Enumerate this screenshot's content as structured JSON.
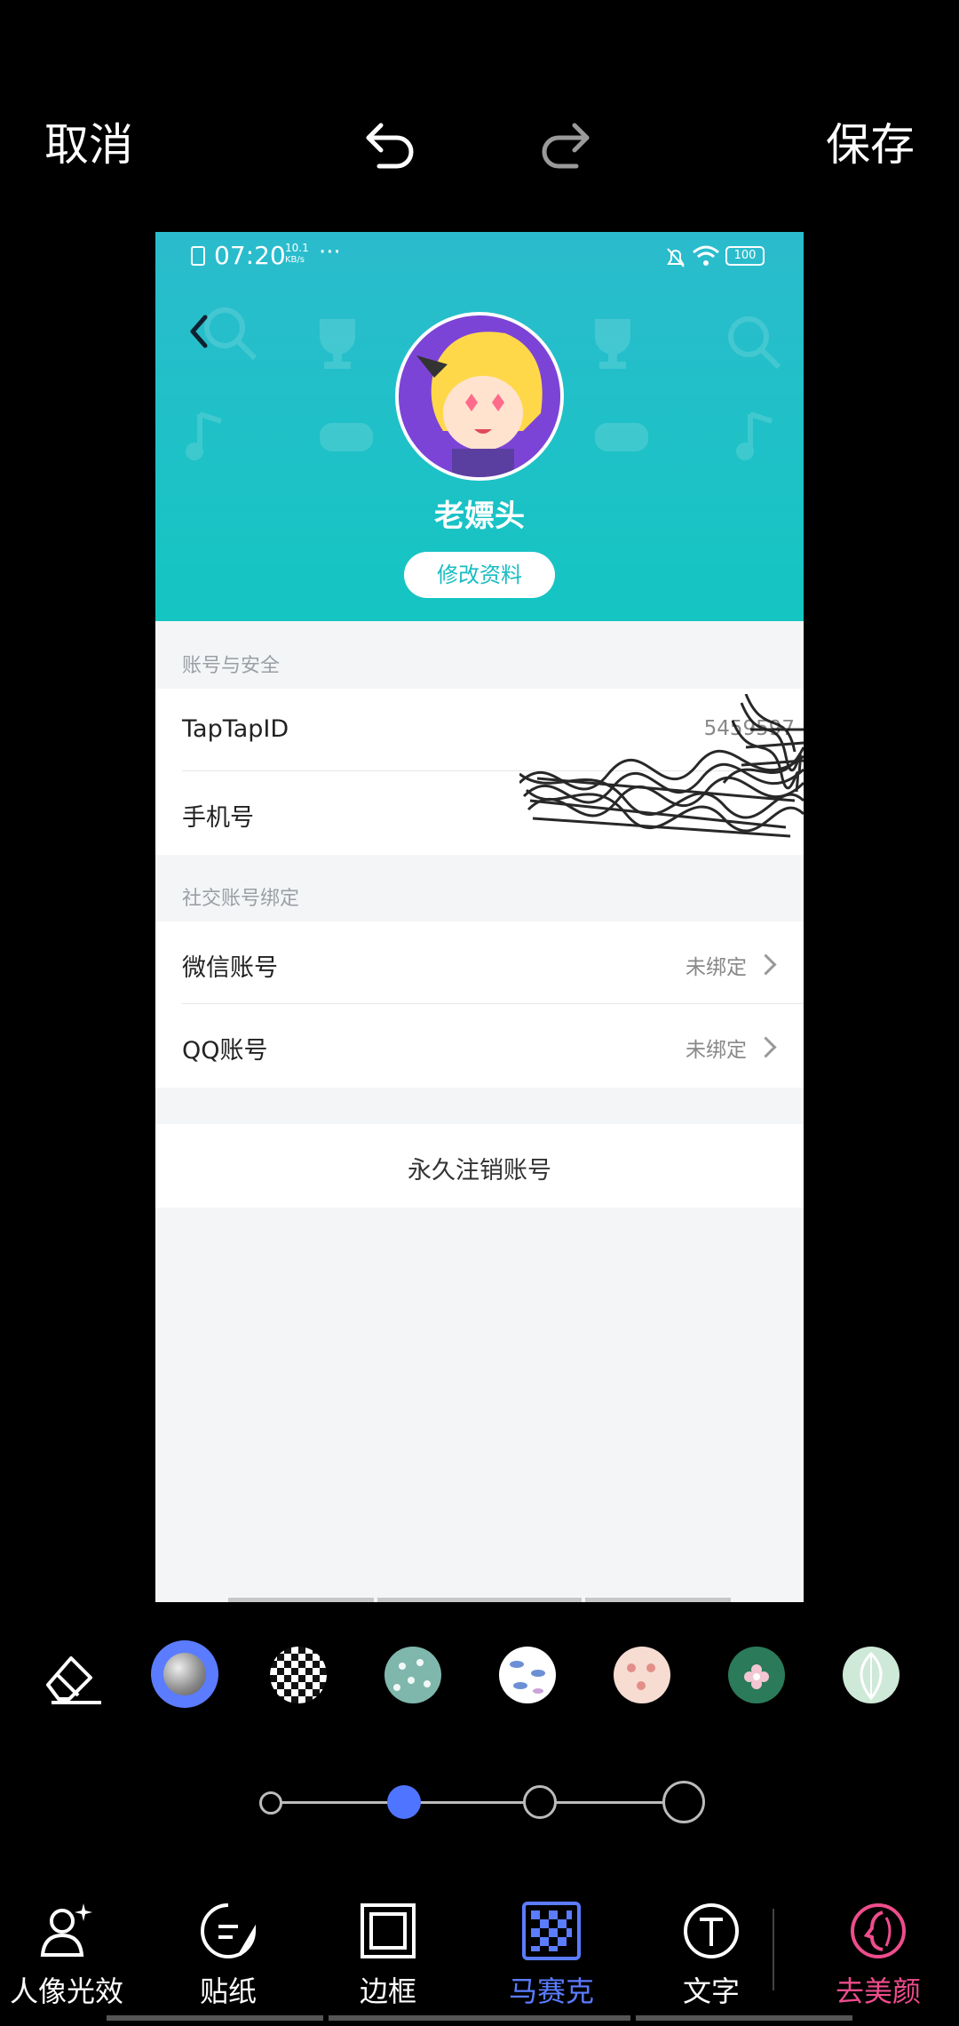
{
  "topbar": {
    "cancel_label": "取消",
    "save_label": "保存"
  },
  "screenshot": {
    "status": {
      "time": "07:20",
      "net_speed_top": "10.1",
      "net_speed_bottom": "KB/s",
      "more": "···",
      "battery": "100"
    },
    "profile": {
      "username": "老嫖头",
      "edit_label": "修改资料"
    },
    "sections": {
      "account_security_label": "账号与安全",
      "social_binding_label": "社交账号绑定"
    },
    "rows": {
      "taptap_id_label": "TapTapID",
      "taptap_id_value": "5459597",
      "phone_label": "手机号",
      "wechat_label": "微信账号",
      "wechat_value": "未绑定",
      "qq_label": "QQ账号",
      "qq_value": "未绑定",
      "delete_account_label": "永久注销账号"
    }
  },
  "tools": {
    "swatches": [
      "eraser-icon",
      "mosaic-blur",
      "checker",
      "teal-hearts",
      "blue-fish",
      "pink-pattern",
      "green-flower",
      "leaf-pattern"
    ],
    "selected_swatch": 1,
    "brush_size_level": 2,
    "brush_size_steps": 4
  },
  "bottom_nav": {
    "items": [
      {
        "label": "人像光效",
        "icon": "portrait-light-icon"
      },
      {
        "label": "贴纸",
        "icon": "sticker-icon"
      },
      {
        "label": "边框",
        "icon": "frame-icon"
      },
      {
        "label": "马赛克",
        "icon": "mosaic-icon"
      },
      {
        "label": "文字",
        "icon": "text-icon"
      },
      {
        "label": "去美颜",
        "icon": "face-icon"
      }
    ],
    "active_index": 3,
    "active_color": "#5b7cff",
    "special_color": "#ee4d8c"
  }
}
